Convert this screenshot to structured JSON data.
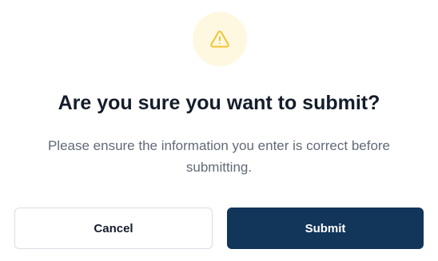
{
  "dialog": {
    "icon": "warning-triangle-icon",
    "title": "Are you sure you want to submit?",
    "message": "Please ensure the information you enter is correct before submitting.",
    "cancel_label": "Cancel",
    "submit_label": "Submit"
  },
  "colors": {
    "icon_bg": "#fef8e1",
    "icon_stroke": "#f2c230",
    "primary": "#12355a",
    "title": "#151d2b",
    "message": "#616b78",
    "border": "#d9dde3"
  }
}
